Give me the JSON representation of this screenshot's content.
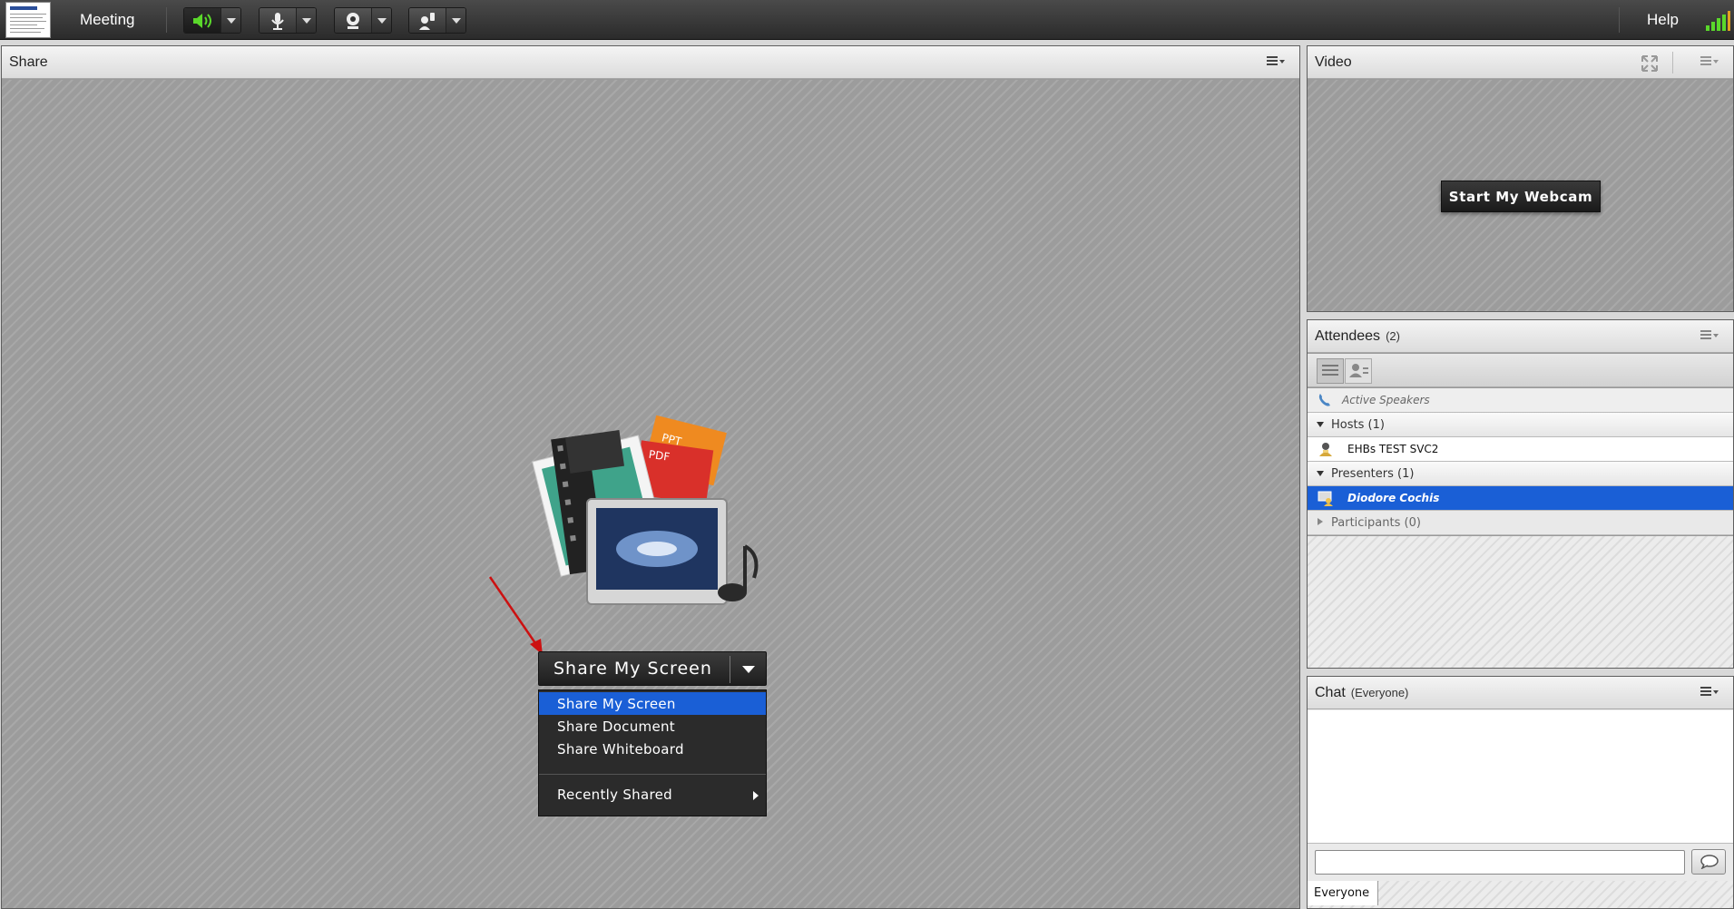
{
  "topbar": {
    "menu_meeting": "Meeting",
    "menu_help": "Help",
    "speaker_color": "#5ad82b"
  },
  "share_pod": {
    "title": "Share",
    "share_button_label": "Share My Screen",
    "dropdown": {
      "items": [
        "Share My Screen",
        "Share Document",
        "Share Whiteboard"
      ],
      "selected": "Share My Screen",
      "recently_shared": "Recently Shared"
    },
    "illustration_labels": {
      "ppt": "PPT",
      "pdf": "PDF"
    },
    "annotation": "red-arrow"
  },
  "video_pod": {
    "title": "Video",
    "webcam_button": "Start My Webcam"
  },
  "attendees_pod": {
    "title": "Attendees",
    "count": "(2)",
    "active_speakers": "Active Speakers",
    "hosts_header": "Hosts (1)",
    "host_name": "EHBs TEST SVC2",
    "presenters_header": "Presenters (1)",
    "presenter_name": "Diodore Cochis",
    "participants_header": "Participants (0)",
    "highlight_color": "#1a5fd6"
  },
  "chat_pod": {
    "title": "Chat",
    "audience": "(Everyone)",
    "input_value": "",
    "tab_label": "Everyone"
  }
}
